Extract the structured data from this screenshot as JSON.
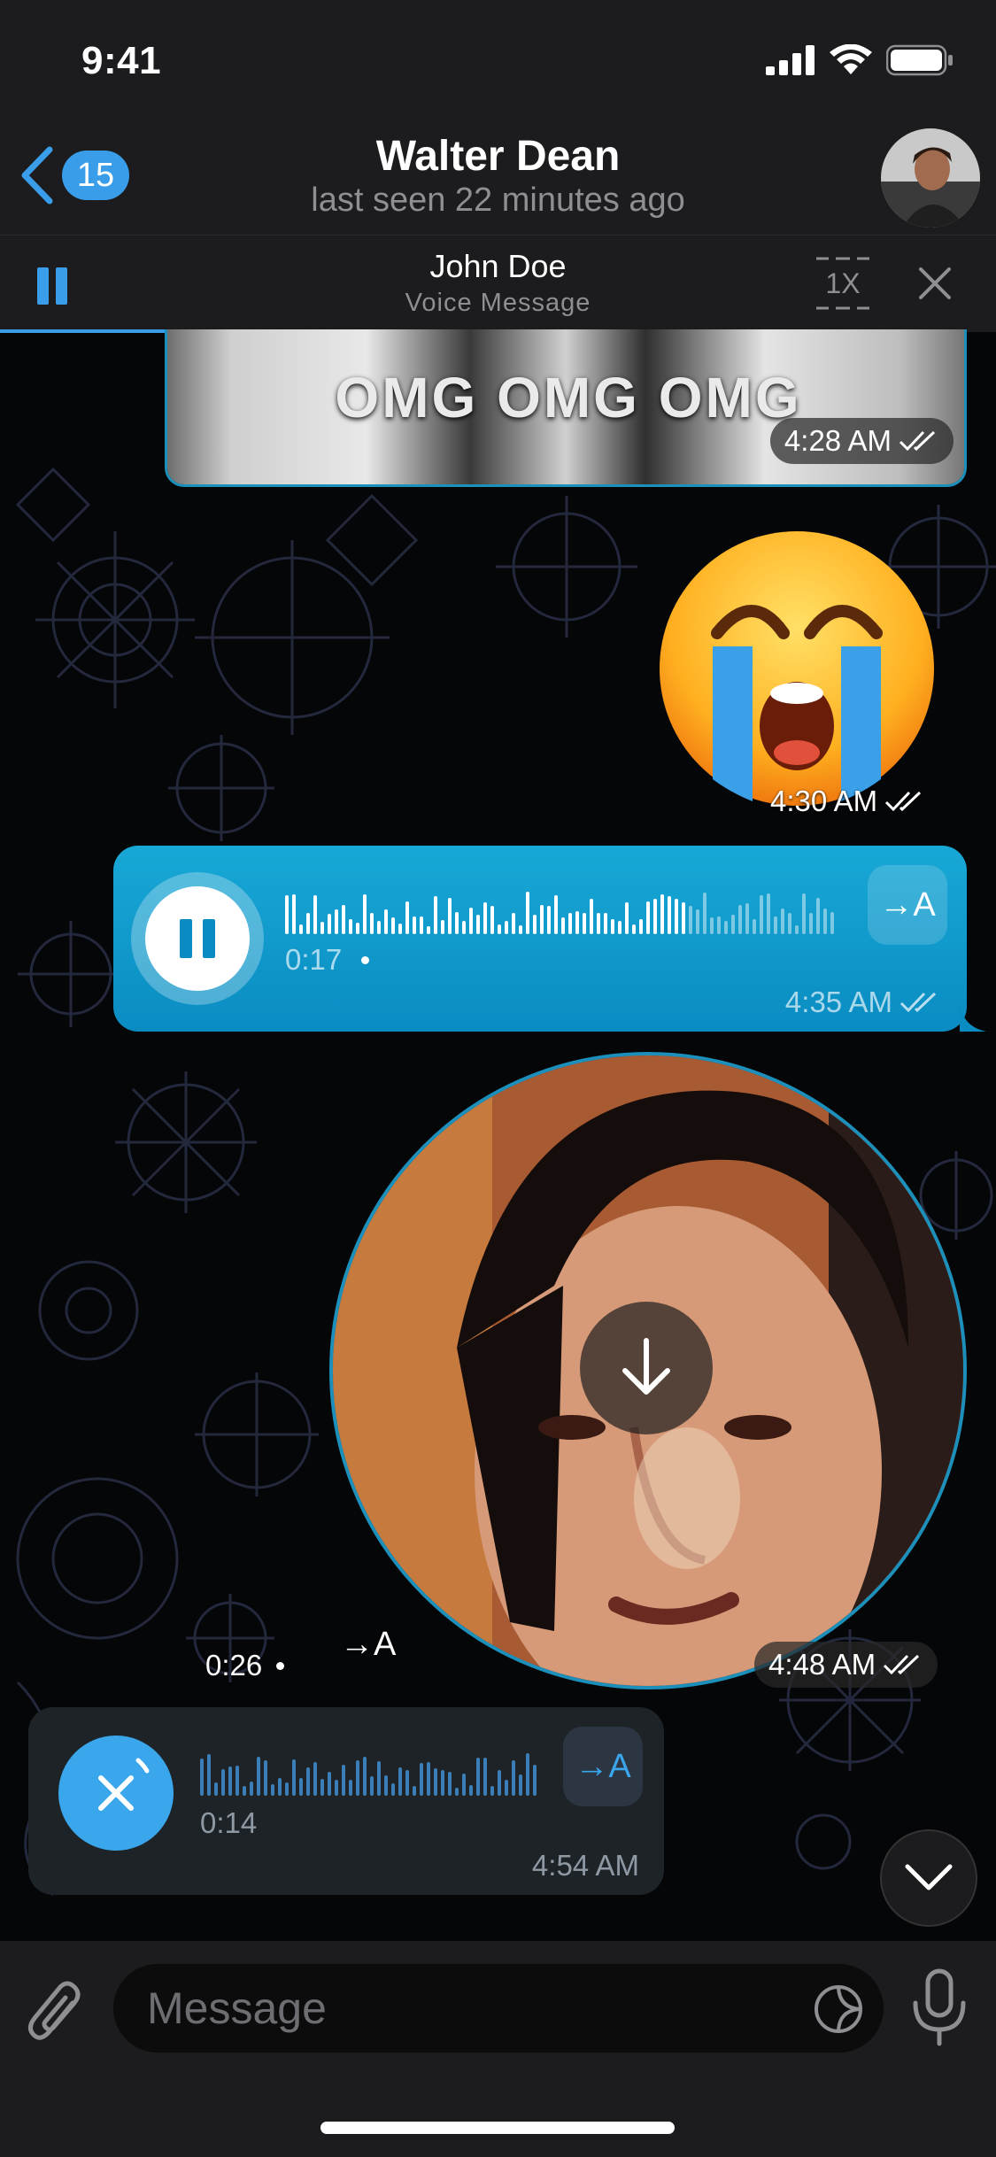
{
  "status_bar": {
    "time": "9:41"
  },
  "header": {
    "back_count": "15",
    "title": "Walter Dean",
    "subtitle": "last seen 22 minutes ago"
  },
  "player": {
    "sender": "John Doe",
    "type": "Voice Message",
    "speed": "1X",
    "progress": 0.7
  },
  "messages": {
    "gif": {
      "caption": "OMG OMG OMG",
      "time": "4:28 AM"
    },
    "emoji": {
      "time": "4:30 AM"
    },
    "voice_outgoing": {
      "duration": "0:17",
      "transcribe": "→A",
      "time": "4:35 AM",
      "played": 0.72
    },
    "video_note": {
      "duration": "0:26",
      "transcribe": "→A",
      "time": "4:48 AM"
    },
    "voice_incoming": {
      "duration": "0:14",
      "transcribe": "→A",
      "time": "4:54 AM"
    }
  },
  "input": {
    "placeholder": "Message"
  },
  "colors": {
    "accent": "#3a9dea",
    "outgoing_bubble": "#0a8cc2",
    "incoming_bubble": "#1e2328",
    "bar": "#1c1c1e"
  }
}
